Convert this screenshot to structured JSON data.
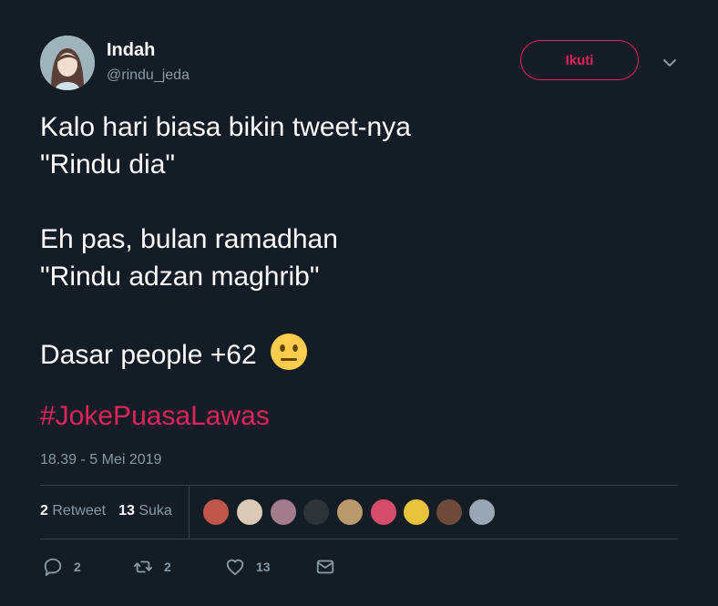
{
  "user": {
    "name": "Indah",
    "handle": "@rindu_jeda"
  },
  "follow_button": {
    "label": "Ikuti"
  },
  "tweet": {
    "lines": [
      "Kalo hari biasa bikin tweet-nya",
      "\"Rindu dia\"",
      "",
      "Eh pas, bulan ramadhan",
      "\"Rindu adzan maghrib\"",
      "",
      "Dasar people +62"
    ],
    "emoji": "neutral-face-icon",
    "hashtag": "#JokePuasaLawas",
    "timestamp": "18.39 - 5 Mei 2019"
  },
  "stats": {
    "retweets_count": "2",
    "retweets_label": "Retweet",
    "likes_count": "13",
    "likes_label": "Suka"
  },
  "likers": [
    {
      "color": "#c0564a"
    },
    {
      "color": "#d9c9b5"
    },
    {
      "color": "#a27b8c"
    },
    {
      "color": "#2e3338"
    },
    {
      "color": "#b89a6c"
    },
    {
      "color": "#d44d6a"
    },
    {
      "color": "#e6c33a"
    },
    {
      "color": "#6d4a3a"
    },
    {
      "color": "#9aa6b3"
    }
  ],
  "actions": {
    "reply_count": "2",
    "retweet_count": "2",
    "like_count": "13"
  },
  "colors": {
    "background": "#141d26",
    "accent": "#e0245e",
    "muted": "#8899a6",
    "divider": "#38444d"
  }
}
